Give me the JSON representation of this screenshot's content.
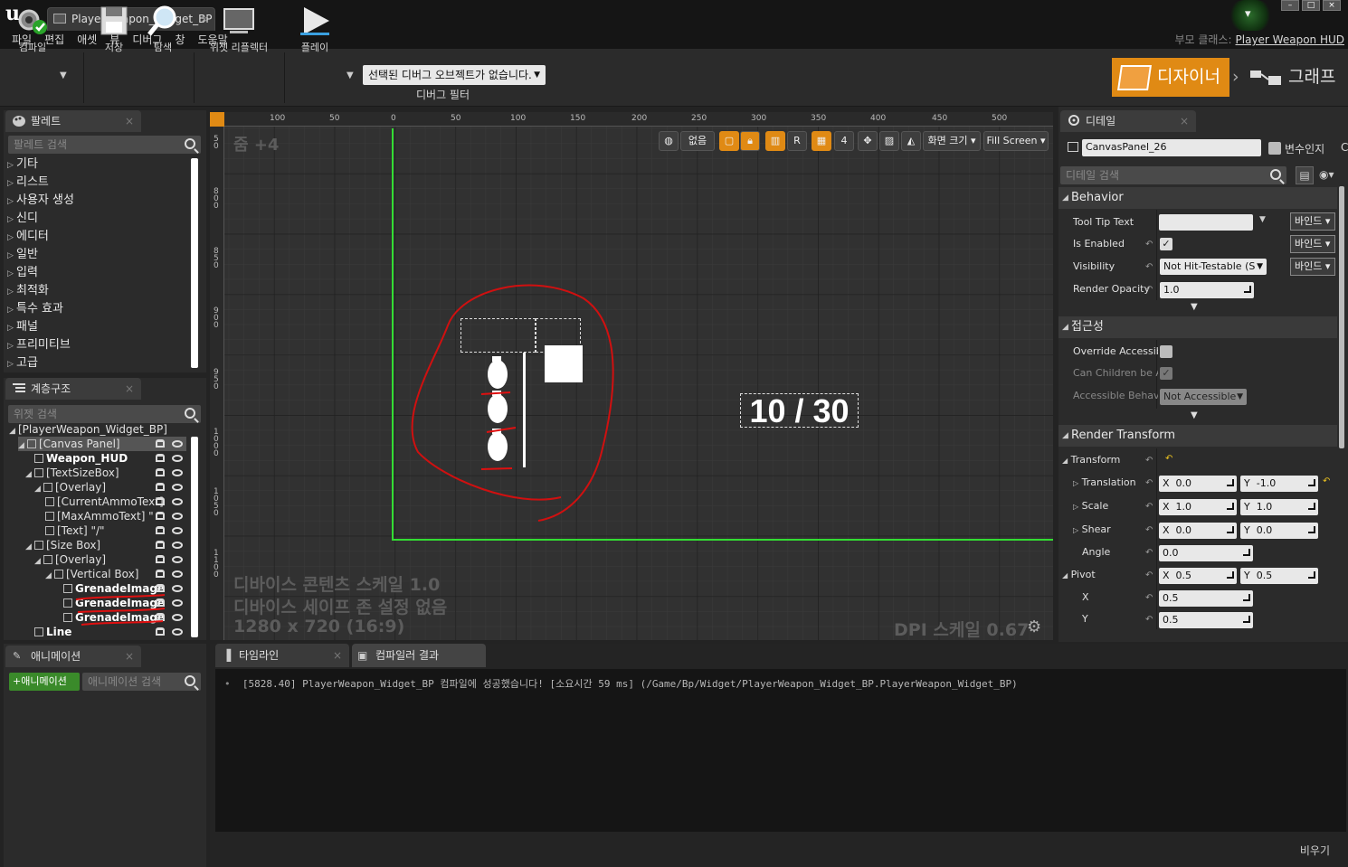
{
  "window": {
    "tab_title": "PlayerWeapon_Widget_BP"
  },
  "menu": [
    "파일",
    "편집",
    "애셋",
    "뷰",
    "디버그",
    "창",
    "도움말"
  ],
  "parent_class": {
    "label": "부모 클래스:",
    "value": "Player Weapon HUD"
  },
  "toolbar": {
    "compile": "컴파일",
    "save": "저장",
    "browse": "탐색",
    "widget_reflector": "위젯 리플렉터",
    "play": "플레이",
    "debug_select": "선택된 디버그 오브젝트가 없습니다.",
    "debug_filter": "디버그 필터",
    "designer": "디자이너",
    "graph": "그래프"
  },
  "palette": {
    "tab": "팔레트",
    "search_placeholder": "팔레트 검색",
    "items": [
      "기타",
      "리스트",
      "사용자 생성",
      "신디",
      "에디터",
      "일반",
      "입력",
      "최적화",
      "특수 효과",
      "패널",
      "프리미티브",
      "고급"
    ]
  },
  "hierarchy": {
    "tab": "계층구조",
    "search_placeholder": "위젯 검색",
    "rows": [
      "[PlayerWeapon_Widget_BP]",
      "[Canvas Panel]",
      "Weapon_HUD",
      "[TextSizeBox]",
      "[Overlay]",
      "[CurrentAmmoText]",
      "[MaxAmmoText] \"",
      "[Text] \"/\"",
      "[Size Box]",
      "[Overlay]",
      "[Vertical Box]",
      "GrenadeImage",
      "GrenadeImage",
      "GrenadeImage",
      "Line"
    ]
  },
  "viewport": {
    "zoom": "줌 +4",
    "ruler_top": [
      "100",
      "50",
      "0",
      "50",
      "100",
      "150",
      "200",
      "250",
      "300",
      "350",
      "400",
      "450",
      "500"
    ],
    "ruler_left": [
      "50",
      "800",
      "850",
      "900",
      "950",
      "1000",
      "1050",
      "1100"
    ],
    "tools": {
      "none": "없음",
      "r": "R",
      "four": "4",
      "screen_size": "화면 크기",
      "fill_screen": "Fill Screen"
    },
    "info_line1": "디바이스 콘텐츠 스케일 1.0",
    "info_line2": "디바이스 세이프 존 설정 없음",
    "info_line3": "1280 x 720 (16:9)",
    "dpi": "DPI 스케일 0.67",
    "ammo_text": "10 / 30"
  },
  "details": {
    "tab": "디테일",
    "name_value": "CanvasPanel_26",
    "is_variable": "변수인지",
    "c_label": "C",
    "search_placeholder": "디테일 검색",
    "behavior": {
      "title": "Behavior",
      "tooltip": "Tool Tip Text",
      "enabled": "Is Enabled",
      "visibility": "Visibility",
      "visibility_value": "Not Hit-Testable (S",
      "opacity": "Render Opacity",
      "opacity_value": "1.0",
      "bind": "바인드"
    },
    "accessibility": {
      "title": "접근성",
      "override": "Override Accessib",
      "children": "Can Children be Ac",
      "behavior": "Accessible Behavi",
      "behavior_value": "Not Accessible"
    },
    "render_transform": {
      "title": "Render Transform",
      "transform": "Transform",
      "translation": "Translation",
      "t_x": "0.0",
      "t_y": "-1.0",
      "scale": "Scale",
      "s_x": "1.0",
      "s_y": "1.0",
      "shear": "Shear",
      "sh_x": "0.0",
      "sh_y": "0.0",
      "angle": "Angle",
      "angle_value": "0.0",
      "pivot": "Pivot",
      "p_x": "0.5",
      "p_y": "0.5",
      "x": "X",
      "y": "Y",
      "x_value": "0.5",
      "y_value": "0.5",
      "lbl_x": "X",
      "lbl_y": "Y"
    }
  },
  "bottom": {
    "anim_tab": "애니메이션",
    "add_anim": "애니메이션",
    "anim_search": "애니메이션 검색",
    "timeline_tab": "타임라인",
    "compiler_tab": "컴파일러 결과",
    "log": "[5828.40] PlayerWeapon_Widget_BP 컴파일에 성공했습니다! [소요시간 59 ms] (/Game/Bp/Widget/PlayerWeapon_Widget_BP.PlayerWeapon_Widget_BP)",
    "clear": "비우기"
  }
}
